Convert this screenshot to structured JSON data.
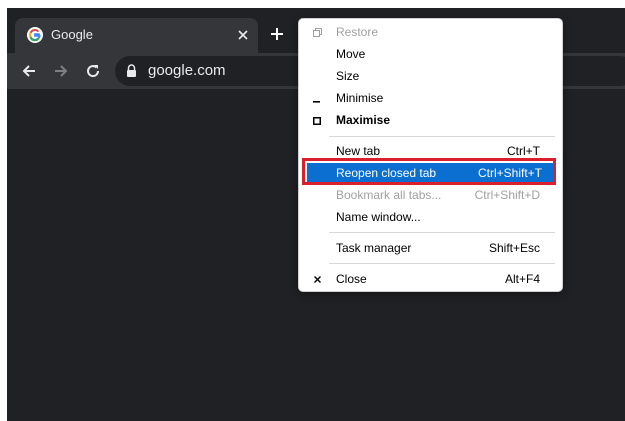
{
  "tab": {
    "title": "Google",
    "favicon": "google-g-icon",
    "close_icon": "close-icon"
  },
  "newtab_icon": "plus-icon",
  "toolbar": {
    "back_icon": "arrow-left-icon",
    "forward_icon": "arrow-right-icon",
    "reload_icon": "reload-icon",
    "lock_icon": "lock-icon",
    "url": "google.com"
  },
  "menu": {
    "items": [
      {
        "label": "Restore",
        "shortcut": "",
        "icon": "restore-icon",
        "disabled": true
      },
      {
        "label": "Move",
        "shortcut": ""
      },
      {
        "label": "Size",
        "shortcut": ""
      },
      {
        "label": "Minimise",
        "shortcut": "",
        "icon": "minimise-icon"
      },
      {
        "label": "Maximise",
        "shortcut": "",
        "icon": "maximise-icon",
        "bold": true
      },
      {
        "label": "New tab",
        "shortcut": "Ctrl+T"
      },
      {
        "label": "Reopen closed tab",
        "shortcut": "Ctrl+Shift+T",
        "highlighted": true
      },
      {
        "label": "Bookmark all tabs...",
        "shortcut": "Ctrl+Shift+D",
        "disabled": true
      },
      {
        "label": "Name window...",
        "shortcut": ""
      },
      {
        "label": "Task manager",
        "shortcut": "Shift+Esc"
      },
      {
        "label": "Close",
        "shortcut": "Alt+F4",
        "icon": "close-icon"
      }
    ]
  },
  "colors": {
    "highlight": "#0a6fd0",
    "annotation_border": "#d9202c",
    "frame": "#202124",
    "toolbar": "#35363a"
  }
}
